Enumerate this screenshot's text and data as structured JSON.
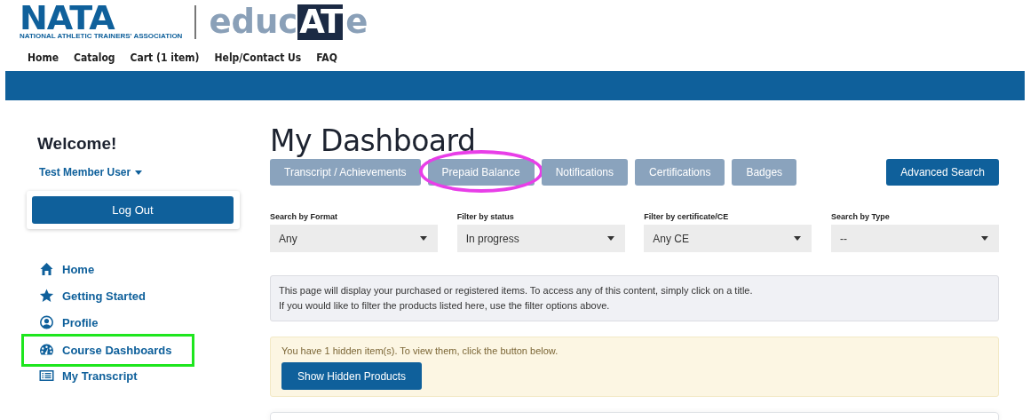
{
  "logo": {
    "org": "NATA",
    "org_tagline": "NATIONAL ATHLETIC TRAINERS' ASSOCIATION",
    "product_parts": [
      "educ",
      "AT",
      "e"
    ]
  },
  "nav": [
    "Home",
    "Catalog",
    "Cart (1 item)",
    "Help/Contact Us",
    "FAQ"
  ],
  "sidebar": {
    "welcome": "Welcome!",
    "user": "Test Member User",
    "logout": "Log Out",
    "items": [
      {
        "label": "Home",
        "boxed": false
      },
      {
        "label": "Getting Started",
        "boxed": false
      },
      {
        "label": "Profile",
        "boxed": false
      },
      {
        "label": "Course Dashboards",
        "boxed": true
      },
      {
        "label": "My Transcript",
        "boxed": false
      }
    ]
  },
  "main": {
    "title": "My Dashboard",
    "tabs": [
      {
        "label": "Transcript / Achievements",
        "circled": false
      },
      {
        "label": "Prepaid Balance",
        "circled": true
      },
      {
        "label": "Notifications",
        "circled": false
      },
      {
        "label": "Certifications",
        "circled": false
      },
      {
        "label": "Badges",
        "circled": false
      }
    ],
    "advanced_search": "Advanced Search",
    "filters": [
      {
        "label": "Search by Format",
        "value": "Any"
      },
      {
        "label": "Filter by status",
        "value": "In progress"
      },
      {
        "label": "Filter by certificate/CE",
        "value": "Any CE"
      },
      {
        "label": "Search by Type",
        "value": "--"
      }
    ],
    "info": [
      "This page will display your purchased or registered items. To access any of this content, simply click on a title.",
      "If you would like to filter the products listed here, use the filter options above."
    ],
    "hidden_notice": "You have 1 hidden item(s). To view them, click the button below.",
    "show_hidden": "Show Hidden Products"
  }
}
